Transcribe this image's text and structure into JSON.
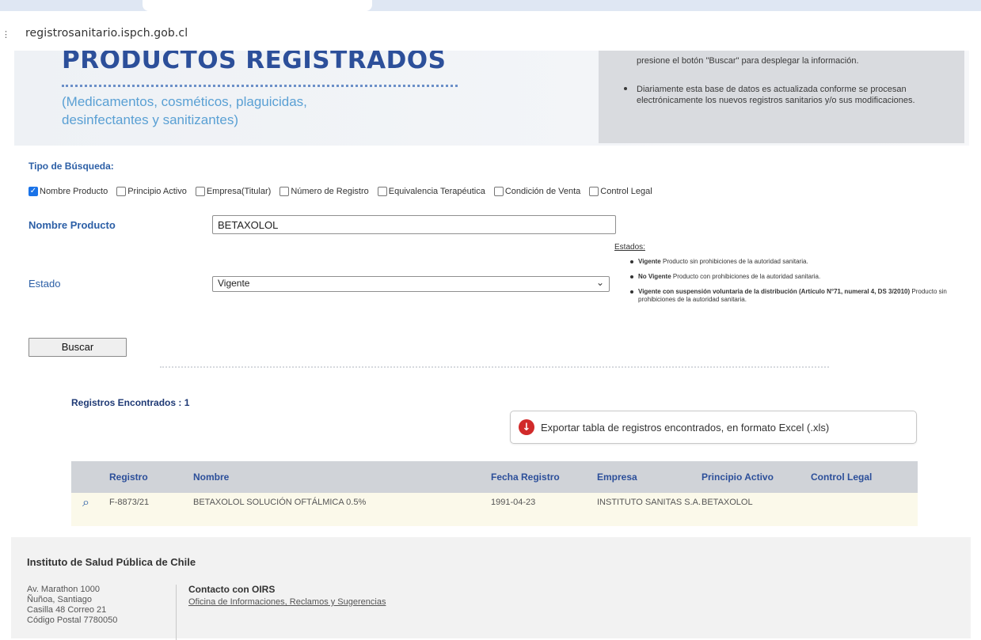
{
  "browser": {
    "url": "registrosanitario.ispch.gob.cl"
  },
  "banner": {
    "title": "PRODUCTOS REGISTRADOS",
    "subtitle": "(Medicamentos, cosméticos, plaguicidas, desinfectantes y sanitizantes)",
    "info_1": "presione el botón \"Buscar\" para desplegar la información.",
    "info_2": "Diariamente esta base de datos es actualizada conforme se procesan electrónicamente los nuevos registros sanitarios y/o sus modificaciones."
  },
  "search": {
    "tipo_label": "Tipo de Búsqueda:",
    "types": [
      {
        "label": "Nombre Producto",
        "checked": true
      },
      {
        "label": "Principio Activo",
        "checked": false
      },
      {
        "label": "Empresa(Titular)",
        "checked": false
      },
      {
        "label": "Número de Registro",
        "checked": false
      },
      {
        "label": "Equivalencia Terapéutica",
        "checked": false
      },
      {
        "label": "Condición de Venta",
        "checked": false
      },
      {
        "label": "Control Legal",
        "checked": false
      }
    ],
    "nombre_label": "Nombre Producto",
    "nombre_value": "BETAXOLOL",
    "estado_label": "Estado",
    "estado_value": "Vigente",
    "buscar_label": "Buscar"
  },
  "estados": {
    "heading": "Estados:",
    "items": [
      {
        "term": "Vigente",
        "desc": "Producto sin prohibiciones de la autoridad sanitaria."
      },
      {
        "term": "No Vigente",
        "desc": "Producto con prohibiciones de la autoridad sanitaria."
      },
      {
        "term": "Vigente con suspensión voluntaria de la distribución (Artículo N°71, numeral 4, DS 3/2010)",
        "desc": "Producto sin prohibiciones de la autoridad sanitaria."
      }
    ]
  },
  "results": {
    "found_label": "Registros Encontrados : 1",
    "export_label": "Exportar tabla de registros encontrados, en formato Excel (.xls)",
    "columns": [
      "Registro",
      "Nombre",
      "Fecha Registro",
      "Empresa",
      "Principio Activo",
      "Control Legal"
    ],
    "rows": [
      {
        "registro": "F-8873/21",
        "nombre": "BETAXOLOL SOLUCIÓN OFTÁLMICA 0.5%",
        "fecha": "1991-04-23",
        "empresa": "INSTITUTO SANITAS S.A.",
        "principio": "BETAXOLOL",
        "control": ""
      }
    ]
  },
  "footer": {
    "title": "Instituto de Salud Pública de Chile",
    "address": [
      "Av. Marathon 1000",
      "Ñuñoa, Santiago",
      "Casilla 48 Correo 21",
      "Código Postal 7780050"
    ],
    "contact_heading": "Contacto con OIRS",
    "contact_link": "Oficina de Informaciones, Reclamos y Sugerencias"
  },
  "icons": {
    "site": "site-info-icon",
    "export": "arrow-down-icon",
    "detail": "magnifier-icon"
  },
  "colors": {
    "brand_blue": "#2c4f9a",
    "label_blue": "#2c5fa6",
    "export_red": "#d12a2a",
    "row_highlight": "#fbf9ea"
  }
}
